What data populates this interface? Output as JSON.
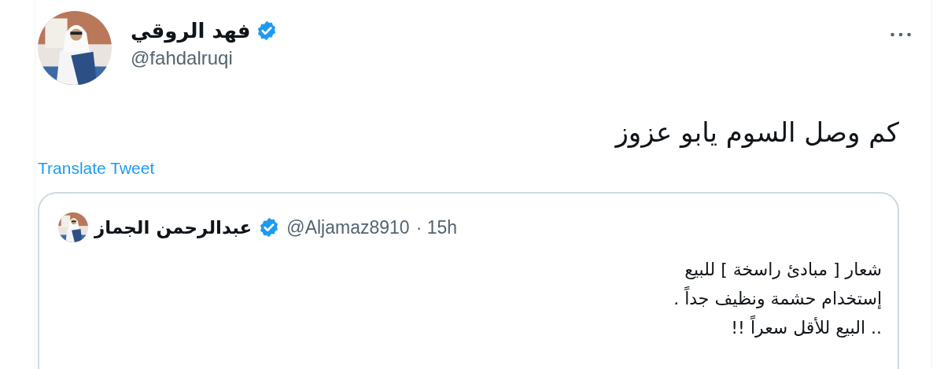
{
  "tweet": {
    "author": {
      "name": "فهد الروقي",
      "verified": true,
      "handle": "@fahdalruqi"
    },
    "text": "كم وصل السوم يابو عزوز",
    "translate_link": "Translate Tweet",
    "quote": {
      "author": {
        "name": "عبدالرحمن الجماز",
        "verified": true,
        "handle": "@Aljamaz8910"
      },
      "time": "· 15h",
      "lines": [
        "شعار [ مبادئ راسخة ] للبيع",
        "إستخدام حشمة ونظيف جداً .",
        ".. البيع للأقل سعراً !!"
      ]
    }
  }
}
